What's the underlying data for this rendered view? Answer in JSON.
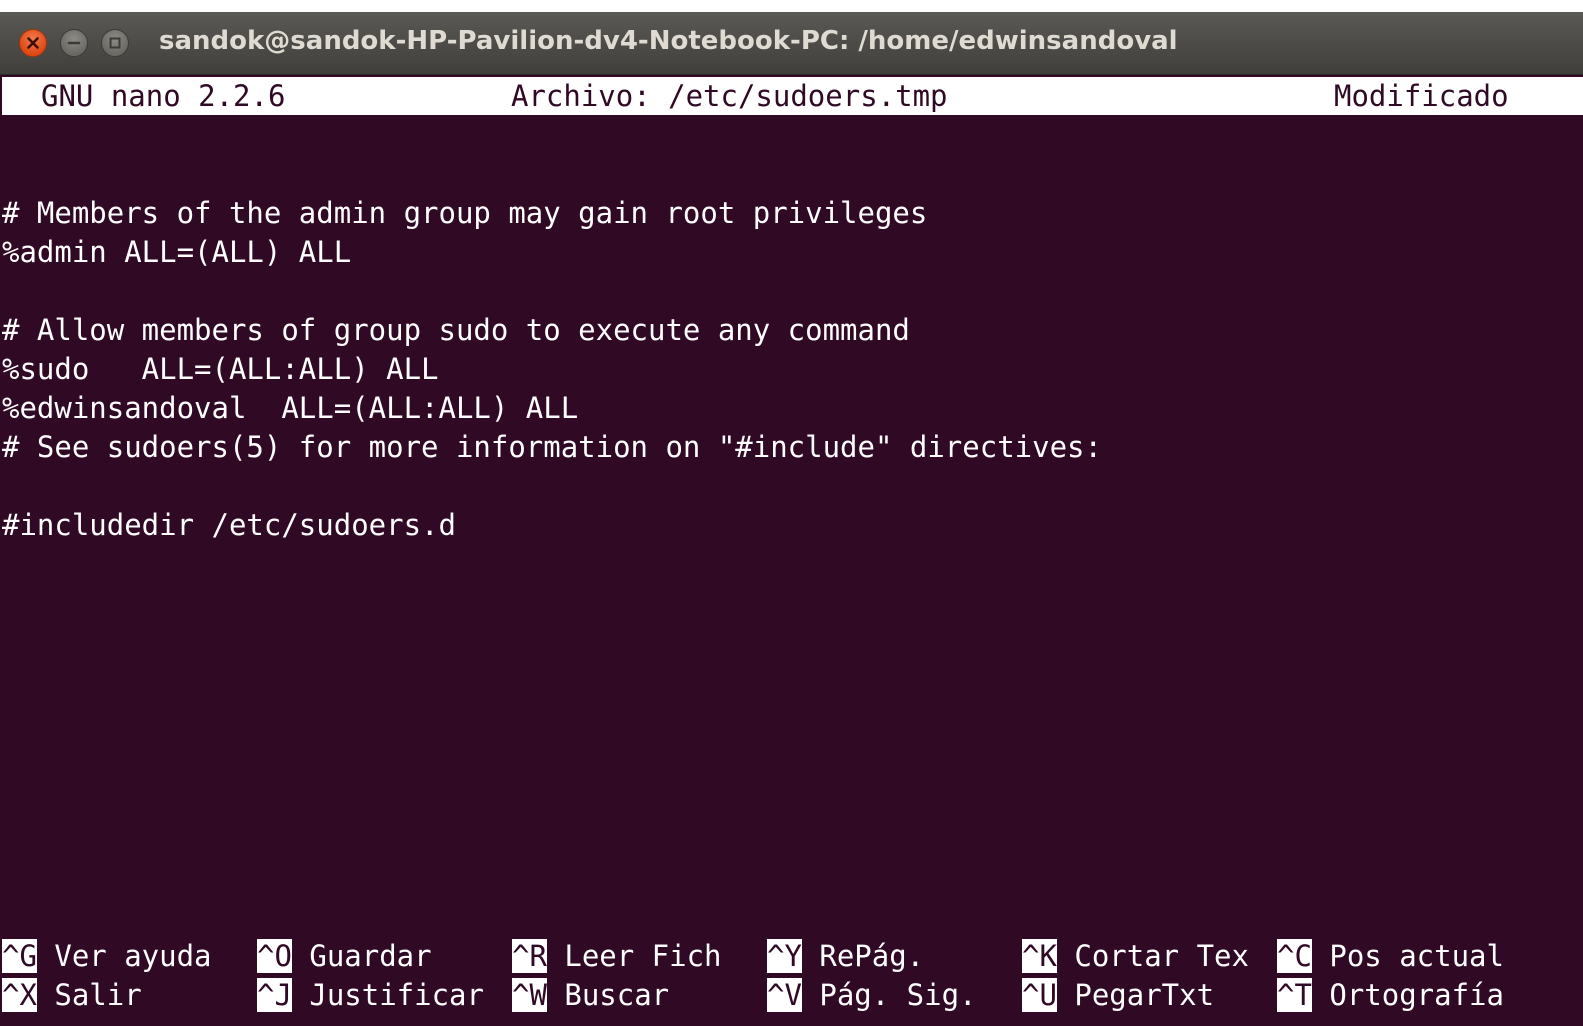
{
  "window": {
    "title": "sandok@sandok-HP-Pavilion-dv4-Notebook-PC: /home/edwinsandoval",
    "buttons": [
      "close-icon",
      "minimize-icon",
      "maximize-icon"
    ]
  },
  "nano": {
    "version": "GNU nano 2.2.6",
    "file": "Archivo: /etc/sudoers.tmp",
    "status": "Modificado"
  },
  "editor": {
    "lines": [
      "# Members of the admin group may gain root privileges",
      "%admin ALL=(ALL) ALL",
      "",
      "# Allow members of group sudo to execute any command",
      "%sudo   ALL=(ALL:ALL) ALL",
      "%edwinsandoval  ALL=(ALL:ALL) ALL",
      "# See sudoers(5) for more information on \"#include\" directives:",
      "",
      "#includedir /etc/sudoers.d"
    ]
  },
  "shortcuts": {
    "row1": [
      {
        "key": "^G",
        "label": " Ver ayuda"
      },
      {
        "key": "^O",
        "label": " Guardar"
      },
      {
        "key": "^R",
        "label": " Leer Fich"
      },
      {
        "key": "^Y",
        "label": " RePág."
      },
      {
        "key": "^K",
        "label": " Cortar Tex"
      },
      {
        "key": "^C",
        "label": " Pos actual"
      }
    ],
    "row2": [
      {
        "key": "^X",
        "label": " Salir"
      },
      {
        "key": "^J",
        "label": " Justificar"
      },
      {
        "key": "^W",
        "label": " Buscar"
      },
      {
        "key": "^V",
        "label": " Pág. Sig."
      },
      {
        "key": "^U",
        "label": " PegarTxt"
      },
      {
        "key": "^T",
        "label": " Ortografía"
      }
    ]
  },
  "colors": {
    "terminal_bg": "#300a24",
    "close_button": "#dd4814",
    "titlebar": "#4a4945"
  }
}
